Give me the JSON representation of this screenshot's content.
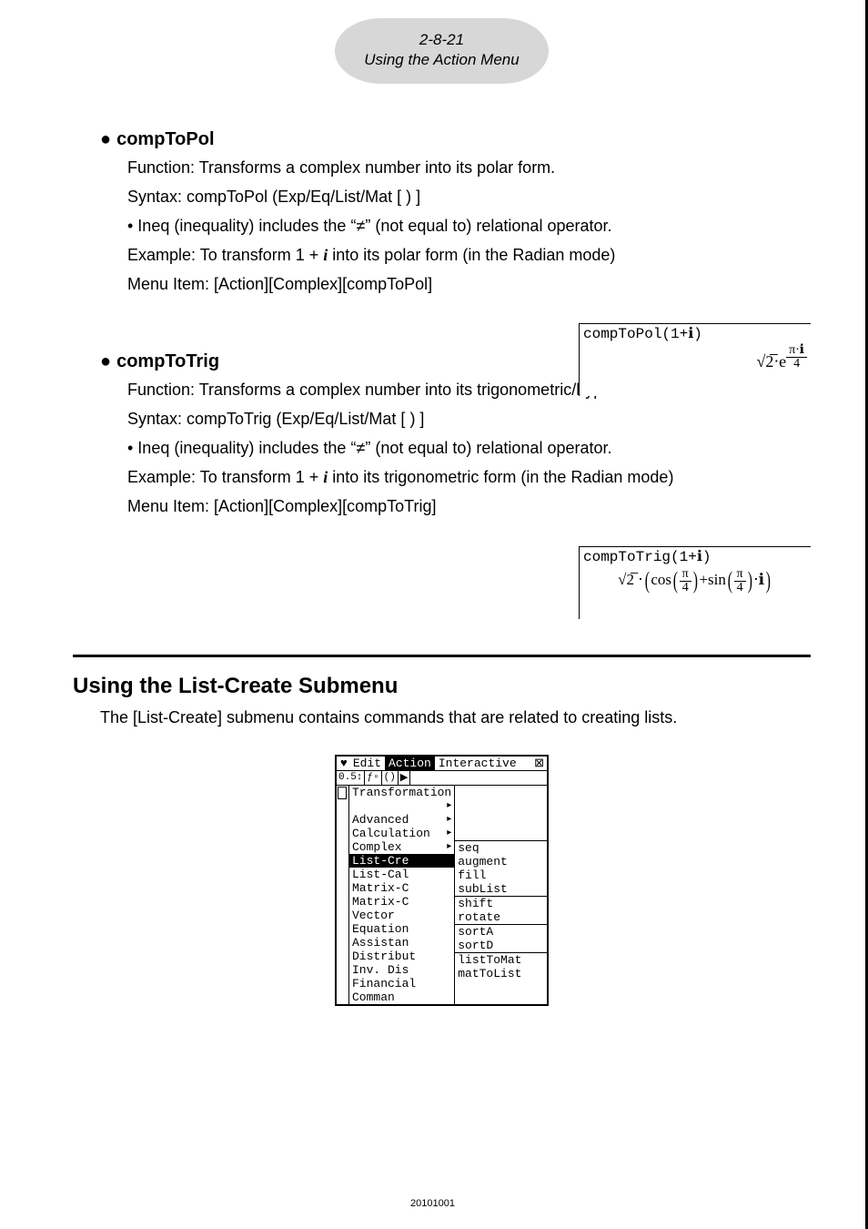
{
  "header": {
    "page_num": "2-8-21",
    "section": "Using the Action Menu"
  },
  "entry1": {
    "title": "compToPol",
    "function": "Function: Transforms a complex number into its polar form.",
    "syntax": "Syntax: compToPol (Exp/Eq/List/Mat [ ) ]",
    "ineq_a": "• Ineq (inequality) includes the “",
    "ineq_b": "” (not equal to) relational operator.",
    "example_a": "Example: To transform 1 + ",
    "example_b": " into its polar form (in the Radian mode)",
    "menu": "Menu Item: [Action][Complex][compToPol]",
    "out_in": "compToPol(1+ℹ)",
    "out_sqrt": "√2̅",
    "out_e": "⋅e",
    "out_pi_i": "π⋅ℹ",
    "out_4": "4"
  },
  "entry2": {
    "title": "compToTrig",
    "function": "Function: Transforms a complex number into its trigonometric/hyperbolic form.",
    "syntax": "Syntax: compToTrig (Exp/Eq/List/Mat [ ) ]",
    "ineq_a": "• Ineq (inequality) includes the “",
    "ineq_b": "” (not equal to) relational operator.",
    "example_a": "Example: To transform 1 + ",
    "example_b": " into its trigonometric form (in the Radian mode)",
    "menu": "Menu Item: [Action][Complex][compToTrig]",
    "out_in": "compToTrig(1+ℹ)",
    "out_sqrt": "√2̅ ⋅",
    "out_cos": "cos",
    "out_plus_sin": "+sin",
    "out_pi": "π",
    "out_4": "4",
    "out_tail": "⋅ℹ"
  },
  "section2": {
    "title": "Using the List-Create Submenu",
    "desc": "The [List-Create] submenu contains commands that are related to creating lists."
  },
  "calc": {
    "menu": {
      "m1": "Edit",
      "m2": "Action",
      "m3": "Interactive"
    },
    "action": [
      "Transformation",
      "Advanced",
      "Calculation",
      "Complex",
      "List-Cre",
      "List-Cal",
      "Matrix-C",
      "Matrix-C",
      "Vector",
      "Equation",
      "Assistan",
      "Distribut",
      "Inv. Dis",
      "Financial",
      "Comman"
    ],
    "sub": [
      "seq",
      "augment",
      "fill",
      "subList",
      "shift",
      "rotate",
      "sortA",
      "sortD",
      "listToMat",
      "matToList"
    ]
  },
  "footer": "20101001",
  "neq": "≠",
  "ivar": "i"
}
